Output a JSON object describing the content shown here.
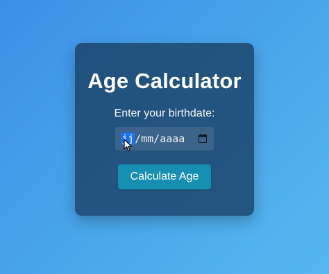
{
  "page": {
    "title": "Age Calculator",
    "label": "Enter your birthdate:"
  },
  "date_input": {
    "day": "jj",
    "sep1": "/",
    "month": "mm",
    "sep2": "/",
    "year": "aaaa",
    "calendar_icon": "calendar-icon"
  },
  "button": {
    "label": "Calculate Age"
  },
  "colors": {
    "card_bg": "#183c60",
    "button_bg": "#168fb3",
    "selection": "#1a73e8"
  }
}
